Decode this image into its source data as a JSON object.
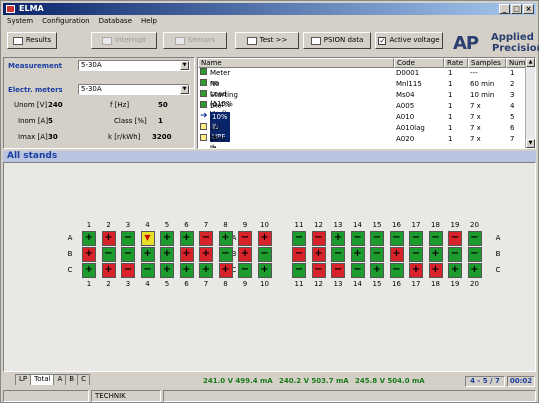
{
  "window": {
    "title": "ELMA",
    "min": "_",
    "max": "□",
    "close": "×"
  },
  "menu": [
    "System",
    "Configuration",
    "Database",
    "Help"
  ],
  "toolbar": {
    "results": "Results",
    "interrupt": "Interrupt",
    "sensors": "Sensors",
    "test": "Test >>",
    "psion": "PSION data",
    "active_voltage": "Active voltage",
    "active_voltage_checked": "✓"
  },
  "logo": {
    "mark": "AP",
    "line1": "Applied",
    "line2": "Precision"
  },
  "left": {
    "measurement_label": "Measurement",
    "measurement_value": "5-30A",
    "meters_label": "Electr. meters",
    "meters_value": "5-30A",
    "params": [
      {
        "k1": "Unom [V]",
        "v1": "240",
        "k2": "f [Hz]",
        "v2": "50"
      },
      {
        "k1": "Inom [A]",
        "v1": "5",
        "k2": "Class [%]",
        "v2": "1"
      },
      {
        "k1": "Imax [A]",
        "v1": "30",
        "k2": "k [r/kWh]",
        "v2": "3200"
      }
    ]
  },
  "table": {
    "headers": [
      "Name",
      "Code",
      "Rate",
      "Samples",
      "Number"
    ],
    "rows": [
      {
        "icon": "check",
        "name": "Meter no",
        "code": "D0001",
        "rate": "1",
        "samples": "---",
        "number": "1"
      },
      {
        "icon": "check",
        "name": "No Load (115% Vref)",
        "code": "Mnl115",
        "rate": "1",
        "samples": "60 min",
        "number": "2"
      },
      {
        "icon": "check",
        "name": "Starting (0.4% Ib)",
        "code": "Ms04",
        "rate": "1",
        "samples": "10 min",
        "number": "3"
      },
      {
        "icon": "check",
        "name": "5% Ib UPF",
        "code": "A005",
        "rate": "1",
        "samples": "7 x",
        "number": "4"
      },
      {
        "icon": "arrow",
        "name": "10% Ib UPF",
        "code": "A010",
        "rate": "1",
        "samples": "7 x",
        "number": "5"
      },
      {
        "icon": "empty",
        "name": "10 % Ib 0.5 LAG",
        "code": "A010lag",
        "rate": "1",
        "samples": "7 x",
        "number": "6"
      },
      {
        "icon": "empty",
        "name": "20% Ib UPF",
        "code": "A020",
        "rate": "1",
        "samples": "7 x",
        "number": "7"
      }
    ]
  },
  "stands": {
    "title": "All stands",
    "columns": [
      "1",
      "2",
      "3",
      "4",
      "5",
      "6",
      "7",
      "8",
      "9",
      "10",
      "11",
      "12",
      "13",
      "14",
      "15",
      "16",
      "17",
      "18",
      "19",
      "20"
    ],
    "rows": [
      {
        "label": "A",
        "cells": [
          "g+",
          "r+",
          "g-",
          "y",
          "g+",
          "g+",
          "r-",
          "g+",
          "r-",
          "r+",
          "g-",
          "r-",
          "g+",
          "g-",
          "g-",
          "g-",
          "g-",
          "g-",
          "r-",
          "g-"
        ]
      },
      {
        "label": "B",
        "cells": [
          "r+",
          "g-",
          "g-",
          "g+",
          "g+",
          "r+",
          "r+",
          "g-",
          "r+",
          "g-",
          "r-",
          "r+",
          "g-",
          "g+",
          "g-",
          "r+",
          "g-",
          "g+",
          "g-",
          "g-"
        ]
      },
      {
        "label": "C",
        "cells": [
          "g+",
          "r+",
          "r-",
          "g-",
          "g+",
          "g+",
          "g+",
          "r+",
          "g-",
          "g+",
          "g-",
          "r-",
          "r-",
          "g-",
          "g+",
          "g-",
          "r+",
          "r+",
          "g+",
          "g+"
        ]
      }
    ]
  },
  "tabs": [
    "LP",
    "Total",
    "A",
    "B",
    "C"
  ],
  "status": {
    "reading_a": "241.0 V 499.4 mA",
    "reading_b": "240.2 V 503.7 mA",
    "reading_c": "245.8 V 504.0 mA",
    "progress": "4 - 5 / 7",
    "time": "00:02",
    "user": "TECHNIK"
  }
}
